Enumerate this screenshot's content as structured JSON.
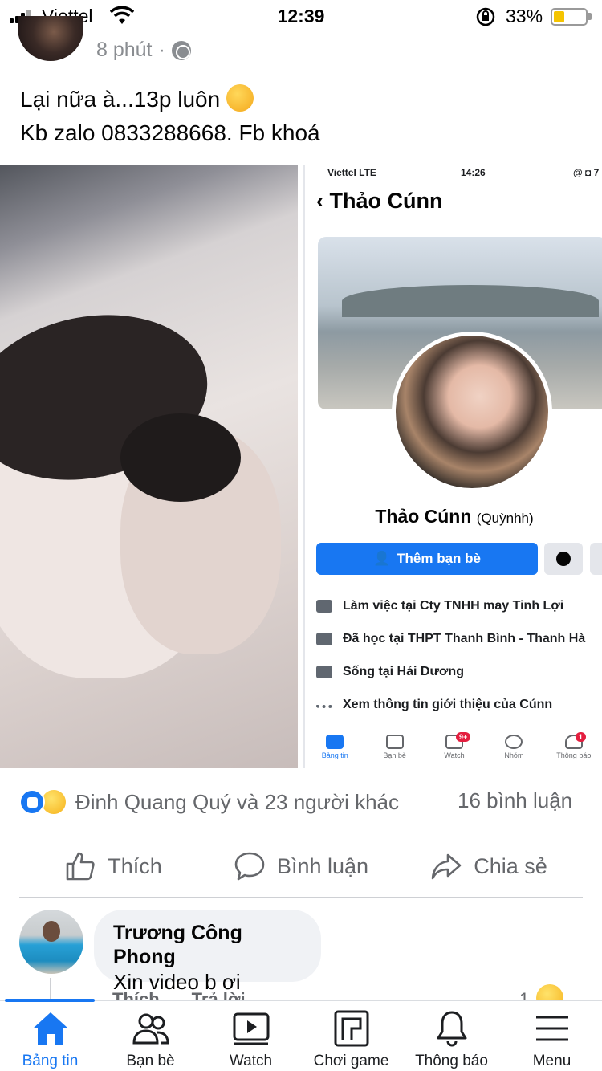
{
  "status_bar": {
    "carrier": "Viettel",
    "time": "12:39",
    "battery_percent": "33%",
    "battery_level": 0.33
  },
  "post": {
    "time_ago": "8 phút",
    "separator": "·",
    "text_line1": "Lại nữa à...13p luôn",
    "text_line2": "Kb zalo 0833288668. Fb khoá"
  },
  "embedded_screenshot": {
    "status": {
      "carrier": "Viettel  LTE",
      "time": "14:26",
      "right": "@ ◘ 7"
    },
    "back": "‹",
    "title": "Thảo Cúnn",
    "profile_name": "Thảo Cúnn",
    "alt_name": "(Quỳnhh)",
    "add_friend": "Thêm bạn bè",
    "info": [
      {
        "icon": "briefcase-icon",
        "text": "Làm việc tại Cty TNHH may Tinh Lợi"
      },
      {
        "icon": "graduation-cap-icon",
        "text": "Đã học tại THPT Thanh Bình - Thanh Hà"
      },
      {
        "icon": "home-icon",
        "text": "Sống tại Hải Dương"
      },
      {
        "icon": "more-dots-icon",
        "text": "Xem thông tin giới thiệu của Cúnn"
      }
    ],
    "tabs": [
      {
        "label": "Bảng tin",
        "badge": ""
      },
      {
        "label": "Bạn bè",
        "badge": ""
      },
      {
        "label": "Watch",
        "badge": "9+"
      },
      {
        "label": "Nhóm",
        "badge": ""
      },
      {
        "label": "Thông báo",
        "badge": "1"
      }
    ]
  },
  "reactions": {
    "summary": "Đinh Quang Quý và 23 người khác",
    "comments": "16 bình luận"
  },
  "actions": {
    "like": "Thích",
    "comment": "Bình luận",
    "share": "Chia sẻ"
  },
  "comment": {
    "author": "Trương Công Phong",
    "text": "Xin video b ơi",
    "like": "Thích",
    "reply": "Trả lời",
    "reaction_count": "1"
  },
  "bottom_nav": [
    {
      "label": "Bảng tin",
      "icon": "home-icon"
    },
    {
      "label": "Bạn bè",
      "icon": "friends-icon"
    },
    {
      "label": "Watch",
      "icon": "watch-icon"
    },
    {
      "label": "Chơi game",
      "icon": "game-icon"
    },
    {
      "label": "Thông báo",
      "icon": "bell-icon"
    },
    {
      "label": "Menu",
      "icon": "menu-icon"
    }
  ],
  "colors": {
    "accent": "#1877f2",
    "badge": "#e41e3f",
    "battery": "#f5c400"
  }
}
